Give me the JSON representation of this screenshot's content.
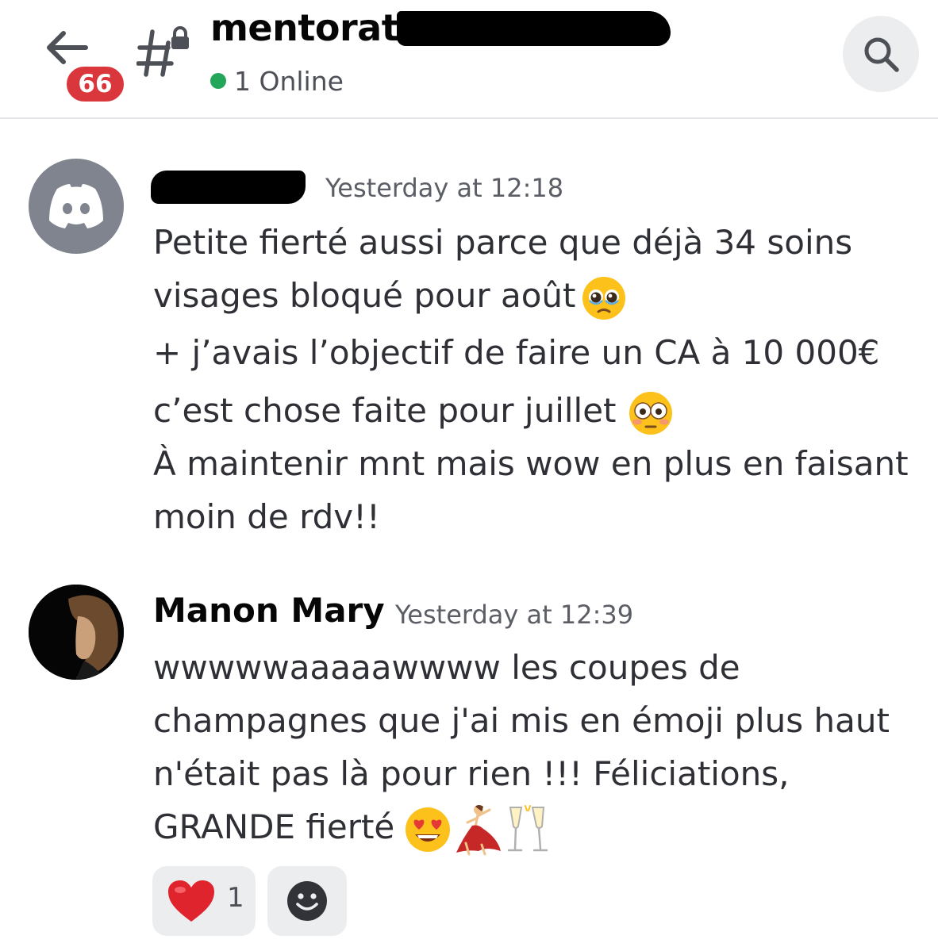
{
  "header": {
    "back_badge_count": "66",
    "channel_name": "mentorat",
    "online_status": "1 Online",
    "colors": {
      "online": "#23a55a",
      "badge": "#da373c"
    },
    "icons": [
      "back-arrow-icon",
      "locked-channel-icon",
      "search-icon"
    ]
  },
  "messages": [
    {
      "author": "",
      "timestamp": "Yesterday at 12:18",
      "lines": [
        "Petite fierté aussi parce que déjà 34 soins",
        "visages bloqué pour août",
        "+ j’avais l’objectif de faire un CA à 10 000€",
        "c’est chose faite pour juillet",
        "À maintenir mnt mais wow en plus en faisant",
        "moin de rdv!!"
      ],
      "emojis": [
        "pleading-face-emoji",
        "flushed-face-emoji"
      ]
    },
    {
      "author": "Manon Mary",
      "timestamp": "Yesterday at 12:39",
      "lines": [
        "wwwwwaaaaawwww les coupes de",
        "champagnes que j'ai mis en émoji plus haut",
        "n'était pas là pour rien !!! Féliciations,",
        "GRANDE fierté"
      ],
      "emojis": [
        "heart-eyes-emoji",
        "dancer-emoji",
        "champagne-glasses-emoji"
      ]
    }
  ],
  "reactions": [
    {
      "emoji": "red-heart-emoji",
      "count": "1"
    }
  ],
  "add_reaction_icon": "smiley-icon"
}
